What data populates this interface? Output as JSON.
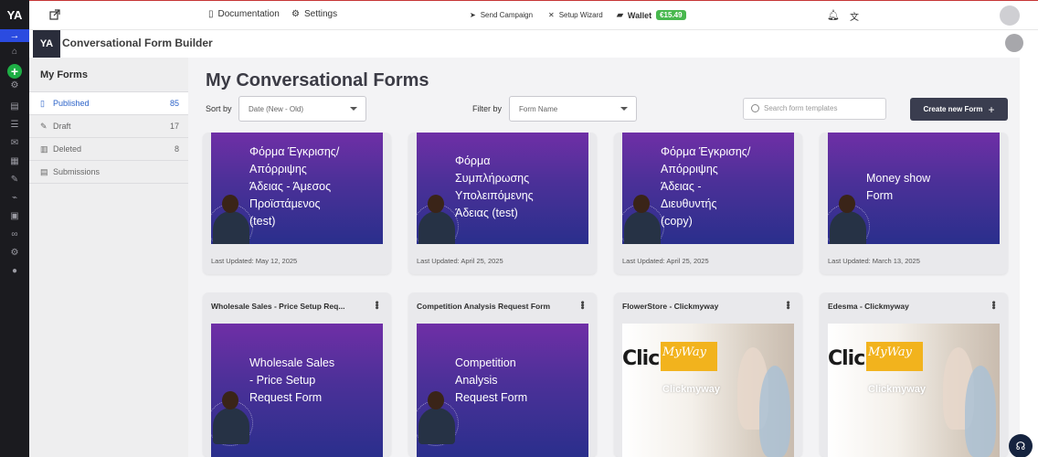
{
  "topbar": {
    "documentation": "Documentation",
    "settings": "Settings",
    "send_campaign": "Send Campaign",
    "setup_wizard": "Setup Wizard",
    "wallet": "Wallet",
    "wallet_balance": "€15.49"
  },
  "app": {
    "logo": "YA",
    "title": "Conversational Form Builder"
  },
  "sidebar": {
    "header": "My Forms",
    "items": [
      {
        "label": "Published",
        "count": "85"
      },
      {
        "label": "Draft",
        "count": "17"
      },
      {
        "label": "Deleted",
        "count": "8"
      },
      {
        "label": "Submissions",
        "count": ""
      }
    ]
  },
  "main": {
    "title": "My Conversational Forms",
    "sort_label": "Sort by",
    "sort_value": "Date (New - Old)",
    "filter_label": "Filter by",
    "filter_value": "Form Name",
    "search_placeholder": "Search form templates",
    "create_button": "Create new Form"
  },
  "cards_top": [
    {
      "thumb_lines": [
        "Φόρμα Έγκρισης/",
        "Απόρριψης",
        "Άδειας - Άμεσος",
        "Προϊστάμενος",
        "(test)"
      ],
      "updated": "Last Updated: May 12, 2025"
    },
    {
      "thumb_lines": [
        "Φόρμα",
        "Συμπλήρωσης",
        "Υπολειπόμενης",
        "Άδειας (test)"
      ],
      "updated": "Last Updated: April 25, 2025"
    },
    {
      "thumb_lines": [
        "Φόρμα Έγκρισης/",
        "Απόρριψης",
        "Άδειας -",
        "Διευθυντής",
        "(copy)"
      ],
      "updated": "Last Updated: April 25, 2025"
    },
    {
      "thumb_lines": [
        "Money show",
        "Form"
      ],
      "updated": "Last Updated: March 13, 2025"
    }
  ],
  "cards_bottom": [
    {
      "title": "Wholesale Sales - Price Setup Req...",
      "thumb_lines": [
        "Wholesale Sales",
        "- Price Setup",
        "Request Form"
      ]
    },
    {
      "title": "Competition Analysis Request Form",
      "thumb_lines": [
        "Competition",
        "Analysis",
        "Request Form"
      ]
    },
    {
      "title": "FlowerStore - Clickmyway",
      "photo": {
        "click": "Click",
        "my": "MyWay",
        "sub": "Clickmyway"
      }
    },
    {
      "title": "Edesma - Clickmyway",
      "photo": {
        "click": "Click",
        "my": "MyWay",
        "sub": "Clickmyway"
      }
    }
  ]
}
